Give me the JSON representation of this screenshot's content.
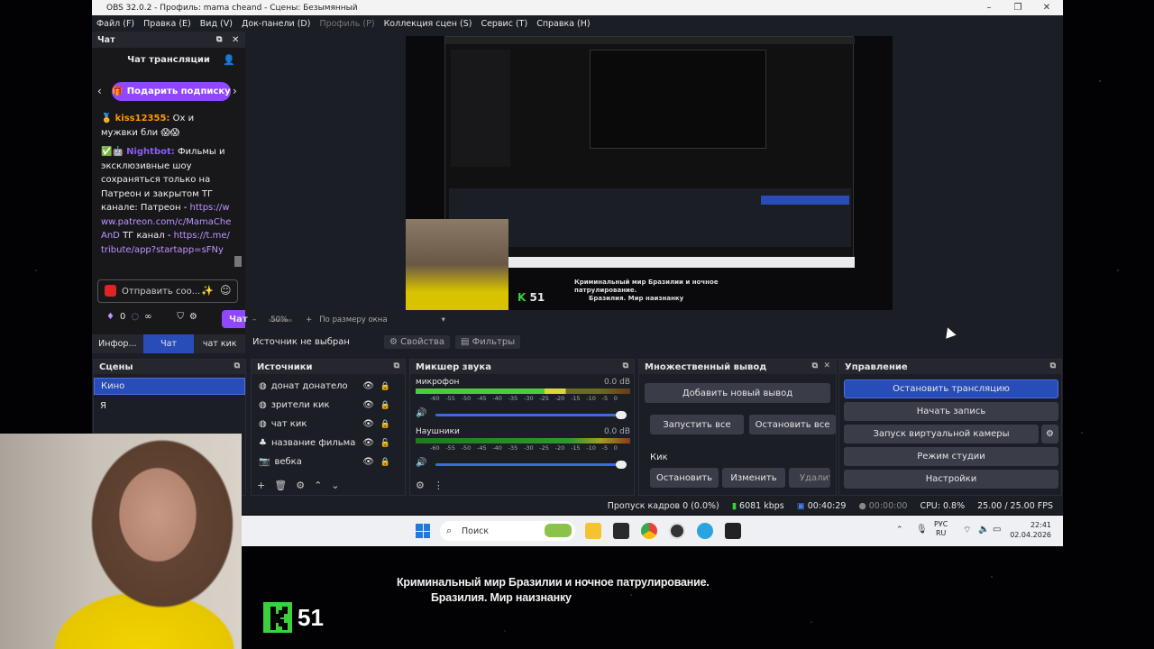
{
  "window": {
    "title": "OBS 32.0.2 - Профиль: mama cheand - Сцены: Безымянный",
    "menu": [
      "Файл (F)",
      "Правка (E)",
      "Вид (V)",
      "Док-панели (D)",
      "Профиль (P)",
      "Коллекция сцен (S)",
      "Сервис (T)",
      "Справка (H)"
    ]
  },
  "chat": {
    "dock_title": "Чат",
    "header": "Чат трансляции",
    "gift_button": "Подарить подписку",
    "msg1_user": "kiss12355:",
    "msg1_text": "Ох и мужвки бли",
    "msg2_user": "Nightbot:",
    "msg2_text": "Фильмы и эксклюзивные шоу сохраняться только на Патреон и закрытом ТГ канале: Патреон -",
    "msg2_link1": "https://www.patreon.com/c/MamaCheAnD",
    "msg2_mid": "ТГ канал -",
    "msg2_link2": "https://t.me/tribute/app?startapp=sFNy",
    "send_placeholder": "Отправить соо...",
    "points": "0",
    "chat_button": "Чат",
    "tabs": [
      "Инфор...",
      "Чат",
      "чат кик"
    ]
  },
  "preview": {
    "zoom": "50%",
    "fit": "По размеру окна",
    "caption_line1": "Криминальный мир Бразилии и ночное патрулирование.",
    "caption_line2": "Бразилия. Мир наизнанку",
    "channel_number": "51"
  },
  "source_bar": {
    "label": "Источник не выбран",
    "properties": "Свойства",
    "filters": "Фильтры"
  },
  "scenes": {
    "title": "Сцены",
    "items": [
      "Кино",
      "Я"
    ]
  },
  "sources": {
    "title": "Источники",
    "items": [
      "донат донатело",
      "зрители кик",
      "чат кик",
      "название фильма",
      "вебка"
    ]
  },
  "mixer": {
    "title": "Микшер звука",
    "channels": [
      {
        "name": "микрофон",
        "db": "0.0 dB"
      },
      {
        "name": "Наушники",
        "db": "0.0 dB"
      }
    ],
    "scale": [
      "-60",
      "-55",
      "-50",
      "-45",
      "-40",
      "-35",
      "-30",
      "-25",
      "-20",
      "-15",
      "-10",
      "-5",
      "0"
    ]
  },
  "multi_output": {
    "title": "Множественный вывод",
    "add_new": "Добавить новый вывод",
    "start_all": "Запустить все",
    "stop_all": "Остановить все",
    "target": "Кик",
    "stop": "Остановить",
    "edit": "Изменить",
    "delete": "Удалит"
  },
  "controls": {
    "title": "Управление",
    "stop_stream": "Остановить трансляцию",
    "start_record": "Начать запись",
    "virtual_cam": "Запуск виртуальной камеры",
    "studio_mode": "Режим студии",
    "settings": "Настройки"
  },
  "status": {
    "dropped": "Пропуск кадров 0 (0.0%)",
    "bitrate": "6081 kbps",
    "stream_time": "00:40:29",
    "rec_time": "00:00:00",
    "cpu": "CPU: 0.8%",
    "fps": "25.00 / 25.00 FPS"
  },
  "taskbar": {
    "search": "Поиск",
    "lang1": "РУС",
    "lang2": "RU",
    "time": "22:41",
    "date": "02.04.2026"
  },
  "colors": {
    "accent": "#284cb8",
    "twitch": "#9147ff",
    "kick": "#3ad13a"
  }
}
